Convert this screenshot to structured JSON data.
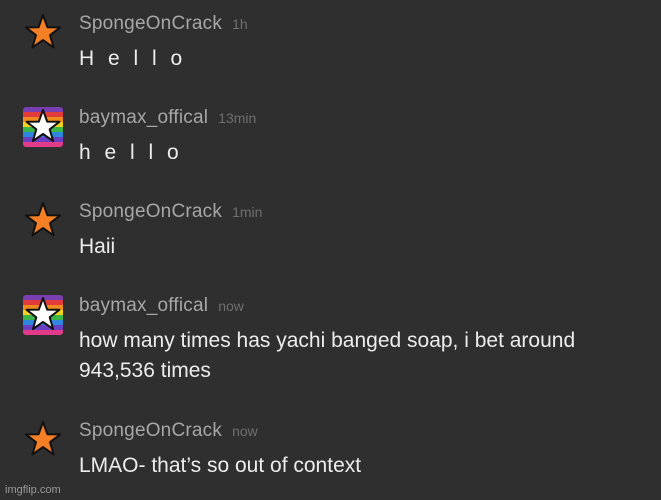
{
  "messages": [
    {
      "username": "SpongeOnCrack",
      "time": "1h",
      "text": "H e l l o",
      "avatar": "orange-star-icon"
    },
    {
      "username": "baymax_offical",
      "time": "13min",
      "text": "h e l l o",
      "avatar": "rainbow-star-icon"
    },
    {
      "username": "SpongeOnCrack",
      "time": "1min",
      "text": "Haii",
      "avatar": "orange-star-icon"
    },
    {
      "username": "baymax_offical",
      "time": "now",
      "text": "how many times has yachi banged soap, i bet around 943,536 times",
      "avatar": "rainbow-star-icon"
    },
    {
      "username": "SpongeOnCrack",
      "time": "now",
      "text": "LMAO- that’s so out of context",
      "avatar": "orange-star-icon"
    }
  ],
  "watermark": "imgflip.com",
  "colors": {
    "background": "#2f2f2f",
    "username": "#a7a7a7",
    "timestamp": "#6f6f6f",
    "message": "#ececec",
    "star_orange": "#f47f24"
  }
}
